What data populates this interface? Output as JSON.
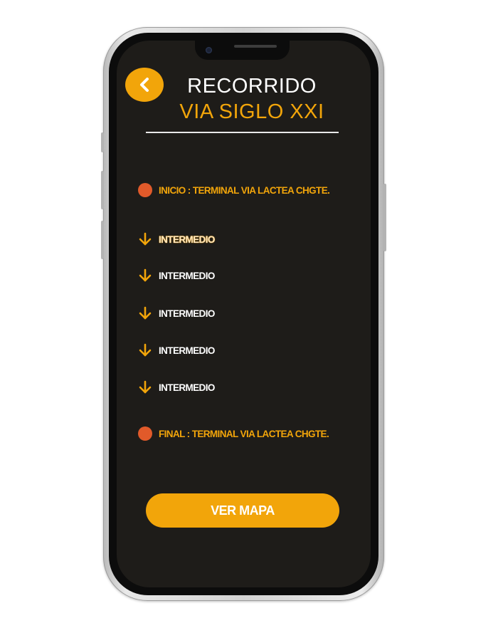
{
  "header": {
    "title_line1": "RECORRIDO",
    "title_line2": "VIA SIGLO XXI",
    "back_icon": "chevron-left-icon"
  },
  "route": {
    "start": {
      "label": "INICIO :  TERMINAL VIA LACTEA CHGTE.",
      "icon": "dot-icon"
    },
    "intermediates": [
      {
        "label": "INTERMEDIO",
        "icon": "arrow-down-icon"
      },
      {
        "label": "INTERMEDIO",
        "icon": "arrow-down-icon"
      },
      {
        "label": "INTERMEDIO",
        "icon": "arrow-down-icon"
      },
      {
        "label": "INTERMEDIO",
        "icon": "arrow-down-icon"
      },
      {
        "label": "INTERMEDIO",
        "icon": "arrow-down-icon"
      }
    ],
    "end": {
      "label": "FINAL :  TERMINAL VIA LACTEA CHGTE.",
      "icon": "dot-icon"
    }
  },
  "actions": {
    "map_button_label": "VER MAPA"
  },
  "colors": {
    "accent": "#f2a50a",
    "dot": "#e15a2a",
    "background": "#1e1c19",
    "text": "#ffffff"
  }
}
